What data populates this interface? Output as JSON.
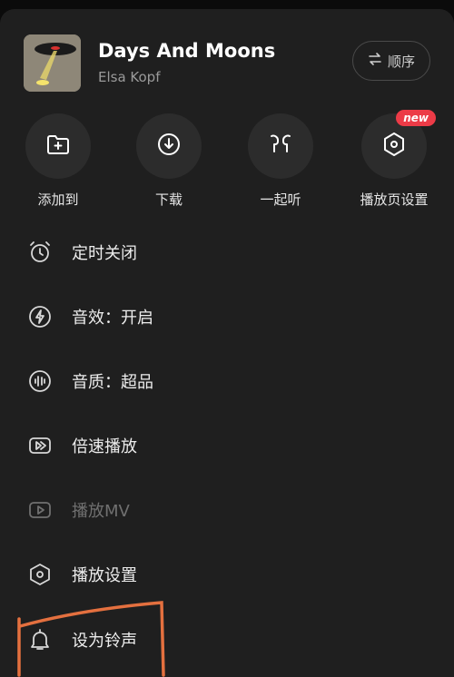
{
  "header": {
    "title": "Days And Moons",
    "artist": "Elsa Kopf",
    "order_label": "顺序"
  },
  "actions": [
    {
      "label": "添加到",
      "icon": "folder-add-icon"
    },
    {
      "label": "下载",
      "icon": "download-icon"
    },
    {
      "label": "一起听",
      "icon": "earbuds-icon"
    },
    {
      "label": "播放页设置",
      "icon": "hexagon-settings-icon",
      "badge": "new"
    }
  ],
  "menu": [
    {
      "label": "定时关闭",
      "icon": "alarm-clock-icon"
    },
    {
      "label": "音效：开启",
      "icon": "lightning-icon"
    },
    {
      "label": "音质：超品",
      "icon": "audio-quality-icon"
    },
    {
      "label": "倍速播放",
      "icon": "speed-play-icon"
    },
    {
      "label": "播放MV",
      "icon": "play-video-icon",
      "disabled": true
    },
    {
      "label": "播放设置",
      "icon": "hexagon-settings-icon"
    },
    {
      "label": "设为铃声",
      "icon": "bell-icon"
    }
  ],
  "colors": {
    "background": "#1f1f1f",
    "action_circle": "#2c2c2c",
    "badge": "#ec3b47",
    "annotation": "#e4703f"
  }
}
